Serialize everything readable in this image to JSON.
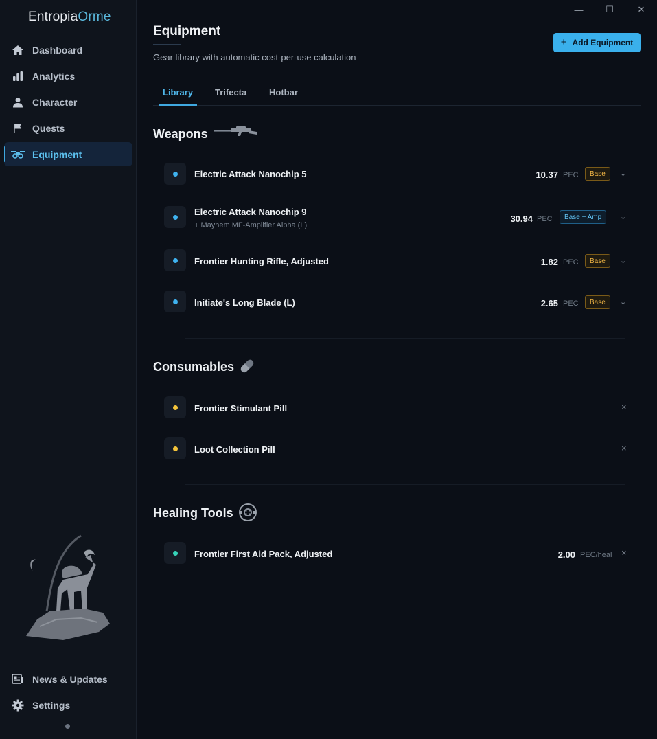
{
  "app": {
    "name_main": "Entropia",
    "name_accent": "Orme"
  },
  "colors": {
    "accent": "#3ab0ec",
    "base_badge": "#f0b545",
    "amp_badge": "#62c2f2",
    "weapon_dot": "#3fb2ef",
    "consumable_dot": "#f3c33a",
    "healing_dot": "#36d3b8"
  },
  "sidebar": {
    "items": [
      {
        "label": "Dashboard",
        "icon": "home-icon"
      },
      {
        "label": "Analytics",
        "icon": "bar-chart-icon"
      },
      {
        "label": "Character",
        "icon": "user-icon"
      },
      {
        "label": "Quests",
        "icon": "flag-icon"
      },
      {
        "label": "Equipment",
        "icon": "drone-icon",
        "active": true
      }
    ],
    "bottom": [
      {
        "label": "News & Updates",
        "icon": "news-icon"
      },
      {
        "label": "Settings",
        "icon": "gear-icon"
      }
    ]
  },
  "window": {
    "minimize": "—",
    "maximize": "☐",
    "close": "✕"
  },
  "header": {
    "title": "Equipment",
    "subtitle": "Gear library with automatic cost-per-use calculation",
    "add_button": "Add Equipment"
  },
  "tabs": [
    {
      "label": "Library",
      "active": true
    },
    {
      "label": "Trifecta"
    },
    {
      "label": "Hotbar"
    }
  ],
  "sections": {
    "weapons": {
      "title": "Weapons",
      "items": [
        {
          "name": "Electric Attack Nanochip 5",
          "sub": "",
          "value": "10.37",
          "unit": "PEC",
          "badge": "Base"
        },
        {
          "name": "Electric Attack Nanochip 9",
          "sub": "+ Mayhem MF-Amplifier Alpha (L)",
          "value": "30.94",
          "unit": "PEC",
          "badge": "Base + Amp"
        },
        {
          "name": "Frontier Hunting Rifle, Adjusted",
          "sub": "",
          "value": "1.82",
          "unit": "PEC",
          "badge": "Base"
        },
        {
          "name": "Initiate's Long Blade (L)",
          "sub": "",
          "value": "2.65",
          "unit": "PEC",
          "badge": "Base"
        }
      ]
    },
    "consumables": {
      "title": "Consumables",
      "items": [
        {
          "name": "Frontier Stimulant Pill"
        },
        {
          "name": "Loot Collection Pill"
        }
      ]
    },
    "healing": {
      "title": "Healing Tools",
      "items": [
        {
          "name": "Frontier First Aid Pack, Adjusted",
          "value": "2.00",
          "unit": "PEC/heal"
        }
      ]
    }
  }
}
